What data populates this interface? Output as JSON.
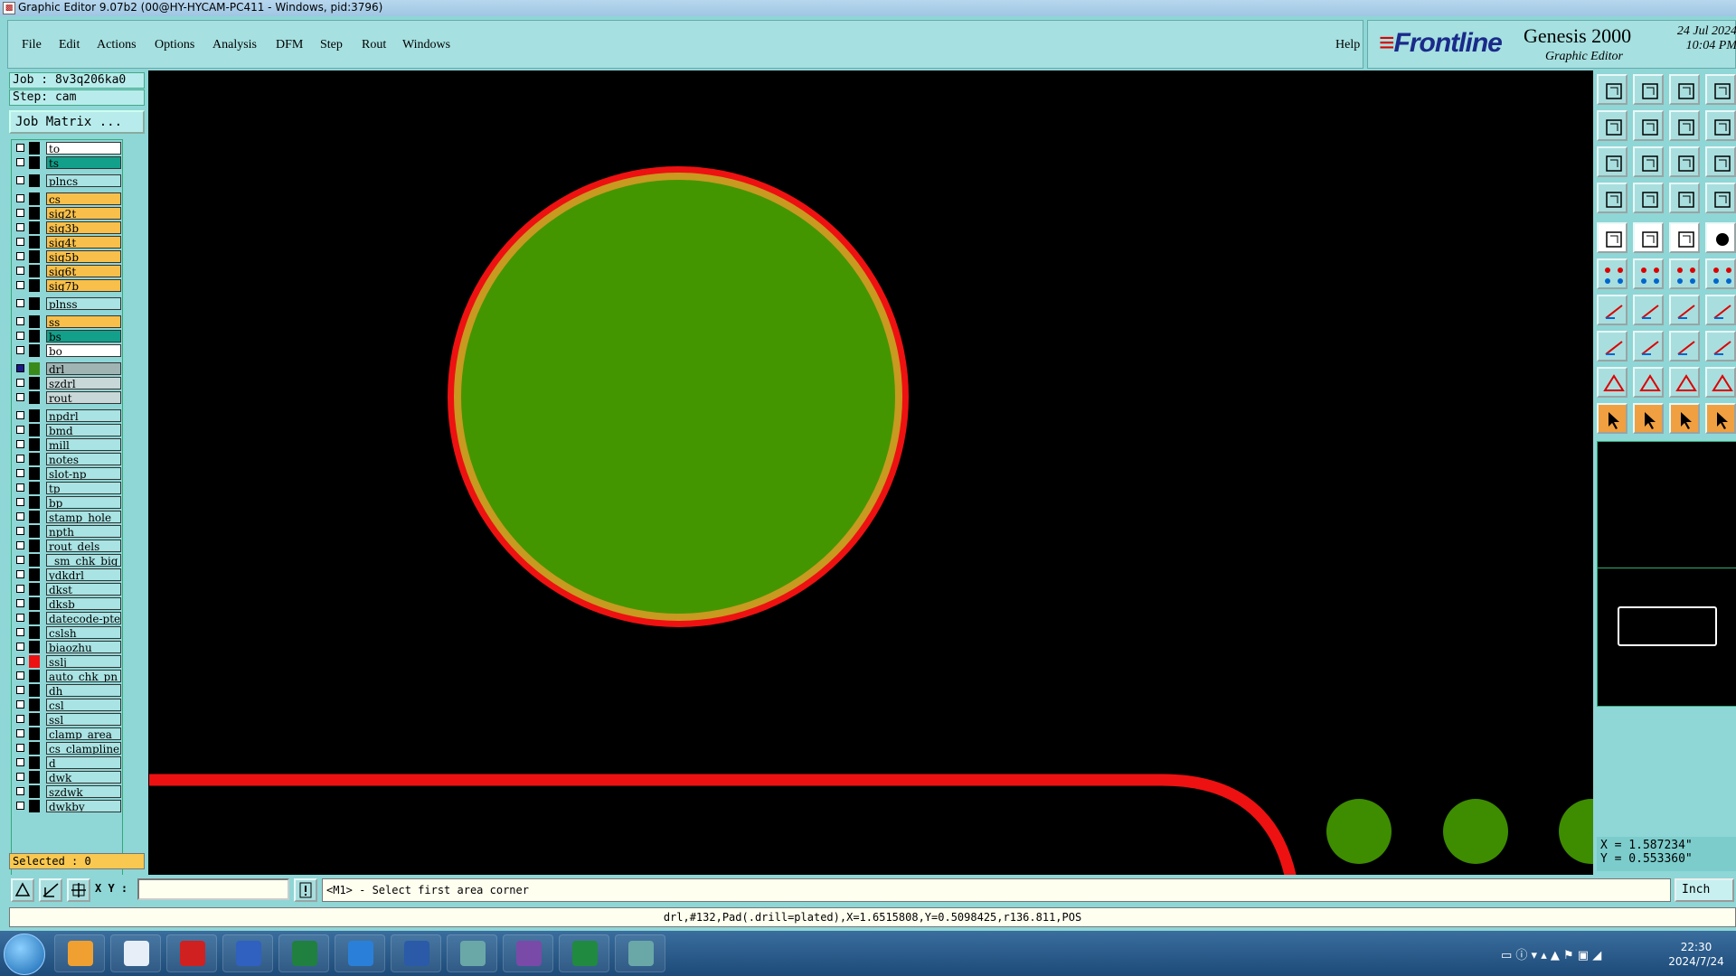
{
  "window": {
    "title": "Graphic Editor 9.07b2 (00@HY-HYCAM-PC411 - Windows, pid:3796)"
  },
  "menu": {
    "items": [
      "File",
      "Edit",
      "Actions",
      "Options",
      "Analysis",
      "DFM",
      "Step",
      "Rout",
      "Windows"
    ],
    "help": "Help"
  },
  "brand": {
    "logo": "Frontline",
    "product": "Genesis 2000",
    "subtitle": "Graphic Editor",
    "date": "24 Jul 2024",
    "time": "10:04 PM"
  },
  "job": {
    "job_label": "Job : 8v3q206ka0",
    "step_label": "Step: cam",
    "matrix_button": "Job Matrix ..."
  },
  "layers": [
    {
      "name": "to",
      "color": "#ffffff",
      "swatch": "#000000",
      "gap_before": false
    },
    {
      "name": "ts",
      "color": "#12a08a",
      "swatch": "#000000",
      "gap_before": false
    },
    {
      "name": "plncs",
      "color": "#a9e3e3",
      "swatch": "#000000",
      "gap_before": true
    },
    {
      "name": "cs",
      "color": "#f8c04a",
      "swatch": "#000000",
      "gap_before": true
    },
    {
      "name": "sig2t",
      "color": "#f8c04a",
      "swatch": "#000000",
      "gap_before": false
    },
    {
      "name": "sig3b",
      "color": "#f8c04a",
      "swatch": "#000000",
      "gap_before": false
    },
    {
      "name": "sig4t",
      "color": "#f8c04a",
      "swatch": "#000000",
      "gap_before": false
    },
    {
      "name": "sig5b",
      "color": "#f8c04a",
      "swatch": "#000000",
      "gap_before": false
    },
    {
      "name": "sig6t",
      "color": "#f8c04a",
      "swatch": "#000000",
      "gap_before": false
    },
    {
      "name": "sig7b",
      "color": "#f8c04a",
      "swatch": "#000000",
      "gap_before": false
    },
    {
      "name": "plnss",
      "color": "#a9e3e3",
      "swatch": "#000000",
      "gap_before": true
    },
    {
      "name": "ss",
      "color": "#f8c04a",
      "swatch": "#000000",
      "gap_before": true
    },
    {
      "name": "bs",
      "color": "#12a08a",
      "swatch": "#000000",
      "gap_before": false
    },
    {
      "name": "bo",
      "color": "#ffffff",
      "swatch": "#000000",
      "gap_before": false
    },
    {
      "name": "drl",
      "color": "#a0b4b4",
      "swatch": "#3a8a1a",
      "gap_before": true,
      "active": true
    },
    {
      "name": "szdrl",
      "color": "#c8d8d8",
      "swatch": "#000000",
      "gap_before": false
    },
    {
      "name": "rout",
      "color": "#c8d8d8",
      "swatch": "#000000",
      "gap_before": false
    },
    {
      "name": "npdrl",
      "color": "#a9e3e3",
      "swatch": "#000000",
      "gap_before": true
    },
    {
      "name": "bmd",
      "color": "#a9e3e3",
      "swatch": "#000000",
      "gap_before": false
    },
    {
      "name": "mill",
      "color": "#a9e3e3",
      "swatch": "#000000",
      "gap_before": false
    },
    {
      "name": "notes",
      "color": "#a9e3e3",
      "swatch": "#000000",
      "gap_before": false
    },
    {
      "name": "slot-np",
      "color": "#a9e3e3",
      "swatch": "#000000",
      "gap_before": false
    },
    {
      "name": "tp",
      "color": "#a9e3e3",
      "swatch": "#000000",
      "gap_before": false
    },
    {
      "name": "bp",
      "color": "#a9e3e3",
      "swatch": "#000000",
      "gap_before": false
    },
    {
      "name": "stamp_hole",
      "color": "#a9e3e3",
      "swatch": "#000000",
      "gap_before": false
    },
    {
      "name": "npth",
      "color": "#a9e3e3",
      "swatch": "#000000",
      "gap_before": false
    },
    {
      "name": "rout_dels",
      "color": "#a9e3e3",
      "swatch": "#000000",
      "gap_before": false
    },
    {
      "name": "_sm_chk_big",
      "color": "#a9e3e3",
      "swatch": "#000000",
      "gap_before": false
    },
    {
      "name": "ydkdrl",
      "color": "#a9e3e3",
      "swatch": "#000000",
      "gap_before": false
    },
    {
      "name": "dkst",
      "color": "#a9e3e3",
      "swatch": "#000000",
      "gap_before": false
    },
    {
      "name": "dksb",
      "color": "#a9e3e3",
      "swatch": "#000000",
      "gap_before": false
    },
    {
      "name": "datecode-pte",
      "color": "#a9e3e3",
      "swatch": "#000000",
      "gap_before": false
    },
    {
      "name": "cslsh",
      "color": "#a9e3e3",
      "swatch": "#000000",
      "gap_before": false
    },
    {
      "name": "biaozhu",
      "color": "#a9e3e3",
      "swatch": "#000000",
      "gap_before": false
    },
    {
      "name": "sslj",
      "color": "#a9e3e3",
      "swatch": "#ee1111",
      "gap_before": false
    },
    {
      "name": "auto_chk_pn",
      "color": "#a9e3e3",
      "swatch": "#000000",
      "gap_before": false
    },
    {
      "name": "dh",
      "color": "#a9e3e3",
      "swatch": "#000000",
      "gap_before": false
    },
    {
      "name": "csl",
      "color": "#a9e3e3",
      "swatch": "#000000",
      "gap_before": false
    },
    {
      "name": "ssl",
      "color": "#a9e3e3",
      "swatch": "#000000",
      "gap_before": false
    },
    {
      "name": "clamp_area",
      "color": "#a9e3e3",
      "swatch": "#000000",
      "gap_before": false
    },
    {
      "name": "cs_clampline",
      "color": "#a9e3e3",
      "swatch": "#000000",
      "gap_before": false
    },
    {
      "name": "d",
      "color": "#a9e3e3",
      "swatch": "#000000",
      "gap_before": false
    },
    {
      "name": "dwk",
      "color": "#a9e3e3",
      "swatch": "#000000",
      "gap_before": false
    },
    {
      "name": "szdwk",
      "color": "#a9e3e3",
      "swatch": "#000000",
      "gap_before": false
    },
    {
      "name": "dwkby",
      "color": "#a9e3e3",
      "swatch": "#000000",
      "gap_before": false
    }
  ],
  "selected_label": "Selected : 0",
  "canvas": {
    "pad_fill": "#449600",
    "pad_ring": "#c89a20",
    "pad_outline": "#ee1111",
    "rout_line": "#ee1111",
    "small_pad": "#3e8c00"
  },
  "toolbar": {
    "rows": [
      [
        "snapshot-icon",
        "load-icon",
        "home-icon",
        "layout-icon"
      ],
      [
        "zoom-prev-icon",
        "zoom-next-icon",
        "zoom-area-icon",
        "zoom-step-icon"
      ],
      [
        "fit-icon",
        "zoom-fit-icon",
        "scale-1to2-icon",
        "help-icon"
      ],
      [
        "measure-icon",
        "grid-icon",
        "layer-compare-icon",
        "layer-compare2-icon"
      ],
      [
        "add-pad-icon",
        "add-line-icon",
        "ruler-icon",
        "add-dot-icon"
      ],
      [
        "nodes-icon",
        "snap-icon",
        "route-icon",
        "route2-icon"
      ],
      [
        "angle-icon",
        "slash-icon",
        "arc-icon",
        "text-f-icon"
      ],
      [
        "pad-shape-icon",
        "line-edit-icon",
        "resize-icon",
        "copy-shapes-icon"
      ],
      [
        "triangle-icon",
        "triangle-a-icon",
        "triangle-b-icon",
        "triangle-c-icon"
      ],
      [
        "select-arrow-icon",
        "select-move-icon",
        "select-rotate-icon",
        "select-group-icon"
      ]
    ]
  },
  "coords": {
    "x": "X = 1.587234\"",
    "y": "Y = 0.553360\""
  },
  "command": {
    "xy_label": "X Y :",
    "xy_value": "",
    "prompt": "<M1> - Select first area corner",
    "units": "Inch"
  },
  "status": {
    "text": "drl,#132,Pad(.drill=plated),X=1.6515808,Y=0.5098425,r136.811,POS"
  },
  "taskbar": {
    "time": "22:30",
    "date": "2024/7/24",
    "apps": [
      "shell-icon",
      "notepad-icon",
      "app-red-icon",
      "save-disk-icon",
      "publisher-icon",
      "arrow-app-icon",
      "word-icon",
      "eye-app-icon",
      "x-app-icon",
      "excel-icon",
      "eye-app2-icon"
    ]
  }
}
